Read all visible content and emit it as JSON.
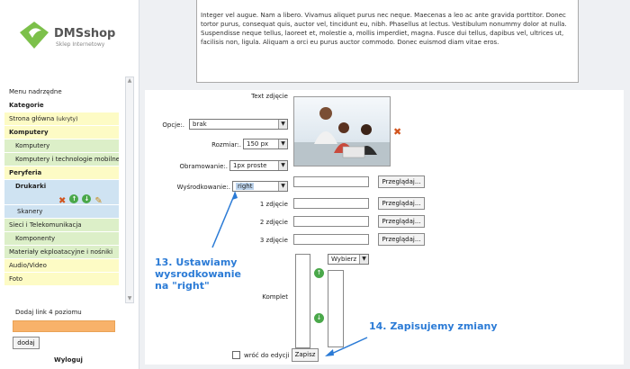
{
  "logo": {
    "name": "DMSshop",
    "tagline": "Sklep Internetowy"
  },
  "sidebar": {
    "items": [
      {
        "label": "Menu nadrzędne",
        "style": "plain"
      },
      {
        "label": "Kategorie",
        "style": "plain-bold"
      },
      {
        "label": "Strona główna",
        "note": "(ukryty)",
        "style": "yellow"
      },
      {
        "label": "Komputery",
        "style": "yellow-bold"
      },
      {
        "label": "Komputery",
        "style": "green"
      },
      {
        "label": "Komputery i technologie mobilne",
        "style": "green"
      },
      {
        "label": "Peryferia",
        "style": "yellow-bold"
      },
      {
        "label": "Drukarki",
        "style": "blue-bold"
      },
      {
        "label": "Skanery",
        "style": "blue"
      },
      {
        "label": "Sieci i Telekomunikacja",
        "style": "green"
      },
      {
        "label": "Komponenty",
        "style": "green"
      },
      {
        "label": "Materiały ekploatacyjne i nośniki",
        "style": "green"
      },
      {
        "label": "Audio/Video",
        "style": "yellow"
      },
      {
        "label": "Foto",
        "style": "yellow"
      }
    ],
    "add_link_label": "Dodaj link 4 poziomu",
    "add_button": "dodaj",
    "logout": "Wyloguj"
  },
  "text_panel": {
    "content": "Integer vel augue. Nam a libero. Vivamus aliquet purus nec neque. Maecenas a leo ac ante gravida porttitor. Donec tortor purus, consequat quis, auctor vel, tincidunt eu, nibh. Phasellus at lectus. Vestibulum nonummy dolor at nulla. Suspendisse neque tellus, laoreet et, molestie a, mollis imperdiet, magna. Fusce dui tellus, dapibus vel, ultrices ut, facilisis non, ligula. Aliquam a orci eu purus auctor commodo. Donec euismod diam vitae eros."
  },
  "form": {
    "text_image_label": "Text zdjęcie",
    "options_label": "Opcje:.",
    "options_value": "brak",
    "size_label": "Rozmiar:.",
    "size_value": "150 px",
    "border_label": "Obramowanie:.",
    "border_value": "1px proste",
    "align_label": "Wyśrodkowanie:.",
    "align_value": "right",
    "browse_label": "Przeglądaj...",
    "image1_label": "1 zdjęcie",
    "image2_label": "2 zdjęcie",
    "image3_label": "3 zdjęcie",
    "set_label": "Komplet",
    "choose_label": "Wybierz",
    "back_label": "wróć do edycji",
    "save_label": "Zapisz"
  },
  "annotations": {
    "step13": "13. Ustawiamy wysrodkowanie na \"right\"",
    "step14": "14. Zapisujemy zmiany"
  }
}
